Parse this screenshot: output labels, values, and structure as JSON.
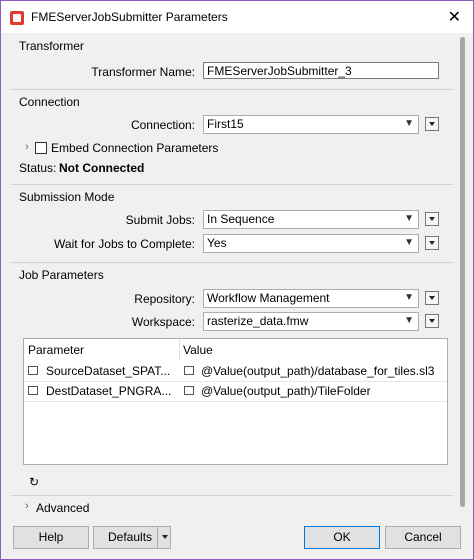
{
  "window": {
    "title": "FMEServerJobSubmitter Parameters",
    "close_glyph": "✕"
  },
  "transformer": {
    "section_title": "Transformer",
    "name_label": "Transformer Name:",
    "name_value": "FMEServerJobSubmitter_3"
  },
  "connection": {
    "section_title": "Connection",
    "connection_label": "Connection:",
    "connection_value": "First15",
    "embed_label": "Embed Connection Parameters",
    "status_label": "Status:",
    "status_value": "Not Connected"
  },
  "submission": {
    "section_title": "Submission Mode",
    "submit_label": "Submit Jobs:",
    "submit_value": "In Sequence",
    "wait_label": "Wait for Jobs to Complete:",
    "wait_value": "Yes"
  },
  "job_parameters": {
    "section_title": "Job Parameters",
    "repository_label": "Repository:",
    "repository_value": "Workflow Management",
    "workspace_label": "Workspace:",
    "workspace_value": "rasterize_data.fmw",
    "table": {
      "headers": [
        "Parameter",
        "Value"
      ],
      "rows": [
        {
          "parameter": "SourceDataset_SPAT...",
          "value": "@Value(output_path)/database_for_tiles.sl3"
        },
        {
          "parameter": "DestDataset_PNGRA...",
          "value": "@Value(output_path)/TileFolder"
        }
      ]
    },
    "refresh_glyph": "↻"
  },
  "advanced": {
    "label": "Advanced"
  },
  "footer": {
    "help_label": "Help",
    "defaults_label": "Defaults",
    "ok_label": "OK",
    "cancel_label": "Cancel"
  },
  "colors": {
    "window_border": "#8a5fc4",
    "primary_button_border": "#0078d7",
    "app_icon": "#e23b2e"
  }
}
